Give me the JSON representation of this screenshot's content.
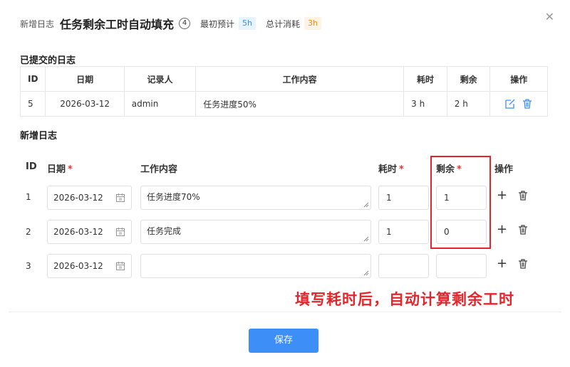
{
  "header": {
    "prefix": "新增日志",
    "title": "任务剩余工时自动填充",
    "count": "4",
    "estimate_label": "最初预计",
    "estimate_value": "5h",
    "consumed_label": "总计消耗",
    "consumed_value": "3h"
  },
  "submitted": {
    "title": "已提交的日志",
    "columns": [
      "ID",
      "日期",
      "记录人",
      "工作内容",
      "耗时",
      "剩余",
      "操作"
    ],
    "rows": [
      {
        "id": "5",
        "date": "2026-03-12",
        "user": "admin",
        "content": "任务进度50%",
        "cost": "3 h",
        "left": "2 h"
      }
    ]
  },
  "new_log": {
    "title": "新增日志",
    "columns": {
      "id": "ID",
      "date": "日期",
      "content": "工作内容",
      "cost": "耗时",
      "left": "剩余",
      "action": "操作"
    },
    "rows": [
      {
        "id": "1",
        "date": "2026-03-12",
        "content": "任务进度70%",
        "cost": "1",
        "left": "1"
      },
      {
        "id": "2",
        "date": "2026-03-12",
        "content": "任务完成",
        "cost": "1",
        "left": "0"
      },
      {
        "id": "3",
        "date": "2026-03-12",
        "content": "",
        "cost": "",
        "left": ""
      }
    ]
  },
  "annotation": "填写耗时后，自动计算剩余工时",
  "save_label": "保存",
  "colors": {
    "primary": "#3e8ef7",
    "annotation": "#e3262b",
    "required": "#e53935"
  }
}
